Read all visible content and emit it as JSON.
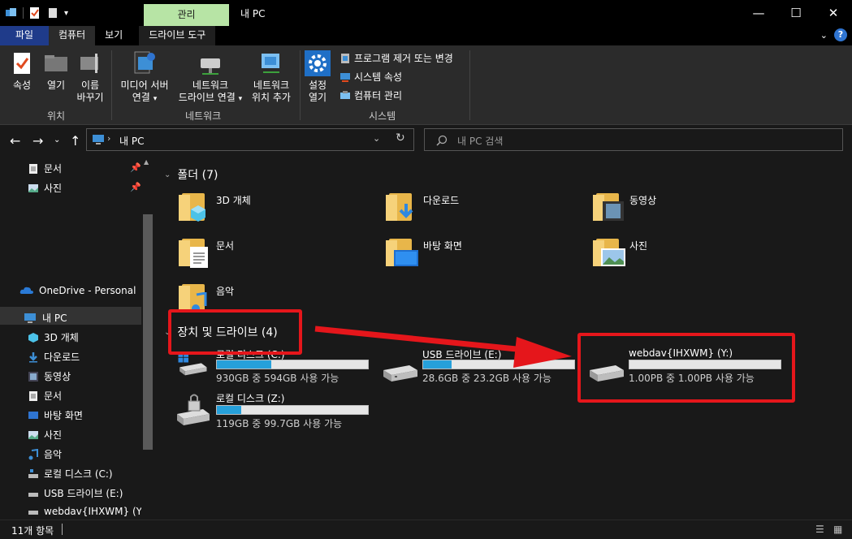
{
  "window": {
    "title": "내 PC",
    "manage_tab": "관리",
    "minimize": "—",
    "maximize": "☐",
    "close": "✕"
  },
  "tabs": {
    "file": "파일",
    "computer": "컴퓨터",
    "view": "보기",
    "drive_tools": "드라이브 도구"
  },
  "ribbon": {
    "location": {
      "label": "위치",
      "properties": "속성",
      "open": "열기",
      "rename_1": "이름",
      "rename_2": "바꾸기"
    },
    "network": {
      "label": "네트워크",
      "media_1": "미디어 서버",
      "media_2": "연결",
      "map_1": "네트워크",
      "map_2": "드라이브 연결",
      "add_1": "네트워크",
      "add_2": "위치 추가"
    },
    "system": {
      "label": "시스템",
      "settings_1": "설정",
      "settings_2": "열기",
      "uninstall": "프로그램 제거 또는 변경",
      "sys_props": "시스템 속성",
      "manage": "컴퓨터 관리"
    }
  },
  "address": {
    "path": "내 PC",
    "search_placeholder": "내 PC 검색"
  },
  "nav": {
    "pinned": [
      {
        "label": "문서"
      },
      {
        "label": "사진"
      }
    ],
    "onedrive": "OneDrive - Personal",
    "thispc": "내 PC",
    "children": [
      {
        "label": "3D 개체"
      },
      {
        "label": "다운로드"
      },
      {
        "label": "동영상"
      },
      {
        "label": "문서"
      },
      {
        "label": "바탕 화면"
      },
      {
        "label": "사진"
      },
      {
        "label": "음악"
      },
      {
        "label": "로컬 디스크 (C:)"
      },
      {
        "label": "USB 드라이브 (E:)"
      },
      {
        "label": "webdav{IHXWM} (Y:)"
      }
    ]
  },
  "folders_section": {
    "title": "폴더 (7)",
    "items": [
      {
        "label": "3D 개체"
      },
      {
        "label": "다운로드"
      },
      {
        "label": "동영상"
      },
      {
        "label": "문서"
      },
      {
        "label": "바탕 화면"
      },
      {
        "label": "사진"
      },
      {
        "label": "음악"
      }
    ]
  },
  "drives_section": {
    "title": "장치 및 드라이브 (4)",
    "items": [
      {
        "name": "로컬 디스크 (C:)",
        "info": "930GB 중 594GB 사용 가능",
        "used_fraction": 0.36
      },
      {
        "name": "USB 드라이브 (E:)",
        "info": "28.6GB 중 23.2GB 사용 가능",
        "used_fraction": 0.19
      },
      {
        "name": "webdav{IHXWM} (Y:)",
        "info": "1.00PB 중 1.00PB 사용 가능",
        "used_fraction": 0.0
      },
      {
        "name": "로컬 디스크 (Z:)",
        "info": "119GB 중 99.7GB 사용 가능",
        "used_fraction": 0.16
      }
    ]
  },
  "status": {
    "count": "11개 항목"
  },
  "colors": {
    "accent": "#26a0da",
    "highlight": "#e5161b",
    "manage_tab": "#b7e4a5",
    "file_tab": "#1f3b8a"
  }
}
